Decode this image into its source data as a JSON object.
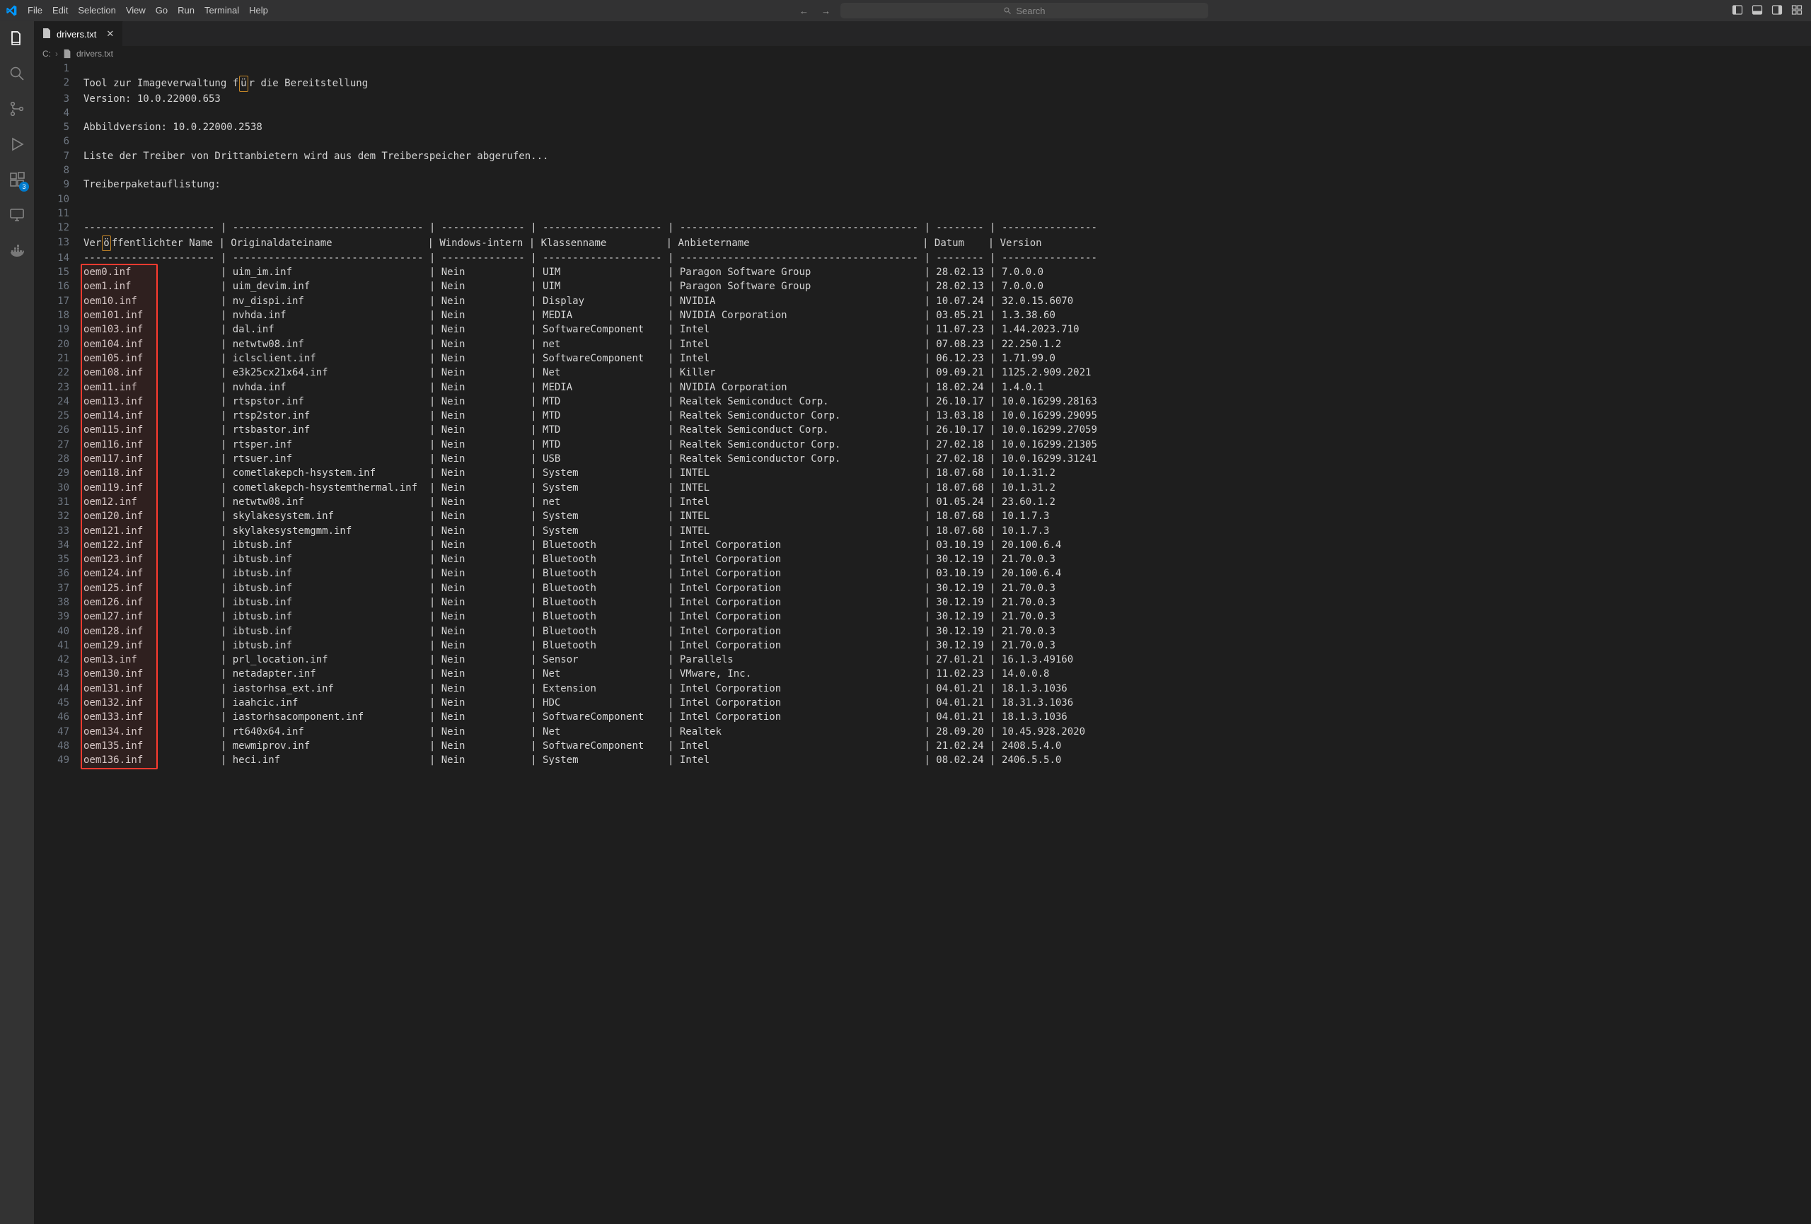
{
  "menu": [
    "File",
    "Edit",
    "Selection",
    "View",
    "Go",
    "Run",
    "Terminal",
    "Help"
  ],
  "search": {
    "placeholder": "Search"
  },
  "tab": {
    "filename": "drivers.txt"
  },
  "breadcrumb": {
    "root": "C:",
    "file": "drivers.txt"
  },
  "badge": {
    "ext": "3"
  },
  "header_text": {
    "2": "Tool zur Imageverwaltung für die Bereitstellung",
    "3": "Version: 10.0.22000.653",
    "5": "Abbildversion: 10.0.22000.2538",
    "7": "Liste der Treiber von Drittanbietern wird aus dem Treiberspeicher abgerufen...",
    "9": "Treiberpaketauflistung:"
  },
  "columns_header": {
    "pub": "Veröffentlichter Name",
    "orig": "Originaldateiname",
    "inbox": "Windows-intern",
    "class": "Klassenname",
    "provider": "Anbietername",
    "date": "Datum",
    "version": "Version"
  },
  "first_data_line_no": 15,
  "rows": [
    {
      "pub": "oem0.inf",
      "orig": "uim_im.inf",
      "inbox": "Nein",
      "class": "UIM",
      "prov": "Paragon Software Group",
      "date": "28.02.13",
      "ver": "7.0.0.0"
    },
    {
      "pub": "oem1.inf",
      "orig": "uim_devim.inf",
      "inbox": "Nein",
      "class": "UIM",
      "prov": "Paragon Software Group",
      "date": "28.02.13",
      "ver": "7.0.0.0"
    },
    {
      "pub": "oem10.inf",
      "orig": "nv_dispi.inf",
      "inbox": "Nein",
      "class": "Display",
      "prov": "NVIDIA",
      "date": "10.07.24",
      "ver": "32.0.15.6070"
    },
    {
      "pub": "oem101.inf",
      "orig": "nvhda.inf",
      "inbox": "Nein",
      "class": "MEDIA",
      "prov": "NVIDIA Corporation",
      "date": "03.05.21",
      "ver": "1.3.38.60"
    },
    {
      "pub": "oem103.inf",
      "orig": "dal.inf",
      "inbox": "Nein",
      "class": "SoftwareComponent",
      "prov": "Intel",
      "date": "11.07.23",
      "ver": "1.44.2023.710"
    },
    {
      "pub": "oem104.inf",
      "orig": "netwtw08.inf",
      "inbox": "Nein",
      "class": "net",
      "prov": "Intel",
      "date": "07.08.23",
      "ver": "22.250.1.2"
    },
    {
      "pub": "oem105.inf",
      "orig": "iclsclient.inf",
      "inbox": "Nein",
      "class": "SoftwareComponent",
      "prov": "Intel",
      "date": "06.12.23",
      "ver": "1.71.99.0"
    },
    {
      "pub": "oem108.inf",
      "orig": "e3k25cx21x64.inf",
      "inbox": "Nein",
      "class": "Net",
      "prov": "Killer",
      "date": "09.09.21",
      "ver": "1125.2.909.2021"
    },
    {
      "pub": "oem11.inf",
      "orig": "nvhda.inf",
      "inbox": "Nein",
      "class": "MEDIA",
      "prov": "NVIDIA Corporation",
      "date": "18.02.24",
      "ver": "1.4.0.1"
    },
    {
      "pub": "oem113.inf",
      "orig": "rtspstor.inf",
      "inbox": "Nein",
      "class": "MTD",
      "prov": "Realtek Semiconduct Corp.",
      "date": "26.10.17",
      "ver": "10.0.16299.28163"
    },
    {
      "pub": "oem114.inf",
      "orig": "rtsp2stor.inf",
      "inbox": "Nein",
      "class": "MTD",
      "prov": "Realtek Semiconductor Corp.",
      "date": "13.03.18",
      "ver": "10.0.16299.29095"
    },
    {
      "pub": "oem115.inf",
      "orig": "rtsbastor.inf",
      "inbox": "Nein",
      "class": "MTD",
      "prov": "Realtek Semiconduct Corp.",
      "date": "26.10.17",
      "ver": "10.0.16299.27059"
    },
    {
      "pub": "oem116.inf",
      "orig": "rtsper.inf",
      "inbox": "Nein",
      "class": "MTD",
      "prov": "Realtek Semiconductor Corp.",
      "date": "27.02.18",
      "ver": "10.0.16299.21305"
    },
    {
      "pub": "oem117.inf",
      "orig": "rtsuer.inf",
      "inbox": "Nein",
      "class": "USB",
      "prov": "Realtek Semiconductor Corp.",
      "date": "27.02.18",
      "ver": "10.0.16299.31241"
    },
    {
      "pub": "oem118.inf",
      "orig": "cometlakepch-hsystem.inf",
      "inbox": "Nein",
      "class": "System",
      "prov": "INTEL",
      "date": "18.07.68",
      "ver": "10.1.31.2"
    },
    {
      "pub": "oem119.inf",
      "orig": "cometlakepch-hsystemthermal.inf",
      "inbox": "Nein",
      "class": "System",
      "prov": "INTEL",
      "date": "18.07.68",
      "ver": "10.1.31.2"
    },
    {
      "pub": "oem12.inf",
      "orig": "netwtw08.inf",
      "inbox": "Nein",
      "class": "net",
      "prov": "Intel",
      "date": "01.05.24",
      "ver": "23.60.1.2"
    },
    {
      "pub": "oem120.inf",
      "orig": "skylakesystem.inf",
      "inbox": "Nein",
      "class": "System",
      "prov": "INTEL",
      "date": "18.07.68",
      "ver": "10.1.7.3"
    },
    {
      "pub": "oem121.inf",
      "orig": "skylakesystemgmm.inf",
      "inbox": "Nein",
      "class": "System",
      "prov": "INTEL",
      "date": "18.07.68",
      "ver": "10.1.7.3"
    },
    {
      "pub": "oem122.inf",
      "orig": "ibtusb.inf",
      "inbox": "Nein",
      "class": "Bluetooth",
      "prov": "Intel Corporation",
      "date": "03.10.19",
      "ver": "20.100.6.4"
    },
    {
      "pub": "oem123.inf",
      "orig": "ibtusb.inf",
      "inbox": "Nein",
      "class": "Bluetooth",
      "prov": "Intel Corporation",
      "date": "30.12.19",
      "ver": "21.70.0.3"
    },
    {
      "pub": "oem124.inf",
      "orig": "ibtusb.inf",
      "inbox": "Nein",
      "class": "Bluetooth",
      "prov": "Intel Corporation",
      "date": "03.10.19",
      "ver": "20.100.6.4"
    },
    {
      "pub": "oem125.inf",
      "orig": "ibtusb.inf",
      "inbox": "Nein",
      "class": "Bluetooth",
      "prov": "Intel Corporation",
      "date": "30.12.19",
      "ver": "21.70.0.3"
    },
    {
      "pub": "oem126.inf",
      "orig": "ibtusb.inf",
      "inbox": "Nein",
      "class": "Bluetooth",
      "prov": "Intel Corporation",
      "date": "30.12.19",
      "ver": "21.70.0.3"
    },
    {
      "pub": "oem127.inf",
      "orig": "ibtusb.inf",
      "inbox": "Nein",
      "class": "Bluetooth",
      "prov": "Intel Corporation",
      "date": "30.12.19",
      "ver": "21.70.0.3"
    },
    {
      "pub": "oem128.inf",
      "orig": "ibtusb.inf",
      "inbox": "Nein",
      "class": "Bluetooth",
      "prov": "Intel Corporation",
      "date": "30.12.19",
      "ver": "21.70.0.3"
    },
    {
      "pub": "oem129.inf",
      "orig": "ibtusb.inf",
      "inbox": "Nein",
      "class": "Bluetooth",
      "prov": "Intel Corporation",
      "date": "30.12.19",
      "ver": "21.70.0.3"
    },
    {
      "pub": "oem13.inf",
      "orig": "prl_location.inf",
      "inbox": "Nein",
      "class": "Sensor",
      "prov": "Parallels",
      "date": "27.01.21",
      "ver": "16.1.3.49160"
    },
    {
      "pub": "oem130.inf",
      "orig": "netadapter.inf",
      "inbox": "Nein",
      "class": "Net",
      "prov": "VMware, Inc.",
      "date": "11.02.23",
      "ver": "14.0.0.8"
    },
    {
      "pub": "oem131.inf",
      "orig": "iastorhsa_ext.inf",
      "inbox": "Nein",
      "class": "Extension",
      "prov": "Intel Corporation",
      "date": "04.01.21",
      "ver": "18.1.3.1036"
    },
    {
      "pub": "oem132.inf",
      "orig": "iaahcic.inf",
      "inbox": "Nein",
      "class": "HDC",
      "prov": "Intel Corporation",
      "date": "04.01.21",
      "ver": "18.31.3.1036"
    },
    {
      "pub": "oem133.inf",
      "orig": "iastorhsacomponent.inf",
      "inbox": "Nein",
      "class": "SoftwareComponent",
      "prov": "Intel Corporation",
      "date": "04.01.21",
      "ver": "18.1.3.1036"
    },
    {
      "pub": "oem134.inf",
      "orig": "rt640x64.inf",
      "inbox": "Nein",
      "class": "Net",
      "prov": "Realtek",
      "date": "28.09.20",
      "ver": "10.45.928.2020"
    },
    {
      "pub": "oem135.inf",
      "orig": "mewmiprov.inf",
      "inbox": "Nein",
      "class": "SoftwareComponent",
      "prov": "Intel",
      "date": "21.02.24",
      "ver": "2408.5.4.0"
    },
    {
      "pub": "oem136.inf",
      "orig": "heci.inf",
      "inbox": "Nein",
      "class": "System",
      "prov": "Intel",
      "date": "08.02.24",
      "ver": "2406.5.5.0"
    }
  ],
  "col_widths": {
    "pub": 22,
    "orig": 32,
    "inbox": 14,
    "class": 20,
    "prov": 40,
    "date": 8
  }
}
